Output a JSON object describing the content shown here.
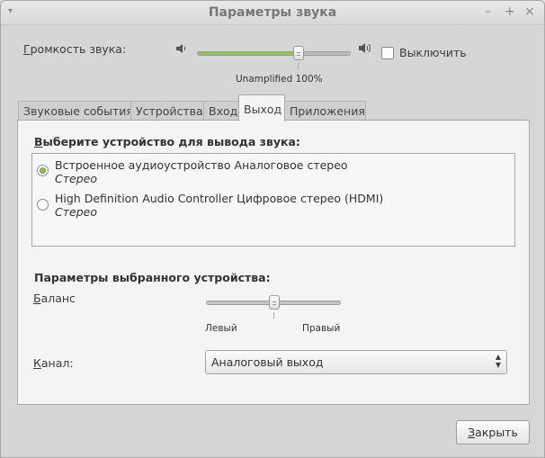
{
  "window": {
    "title": "Параметры звука",
    "menu_glyph": "▾",
    "minimize_glyph": "–",
    "maximize_glyph": "+",
    "close_glyph": "×"
  },
  "volume": {
    "label_first": "Г",
    "label_rest": "ромкость звука:",
    "level_percent": 100,
    "marker_text": "Unamplified 100%",
    "mute_label": "Выключить",
    "mute_checked": false,
    "low_icon": "speaker-low-icon",
    "high_icon": "speaker-high-icon"
  },
  "tabs": [
    {
      "label": "Звуковые события",
      "active": false
    },
    {
      "label": "Устройства",
      "active": false
    },
    {
      "label": "Вход",
      "active": false
    },
    {
      "label": "Выход",
      "active": true
    },
    {
      "label": "Приложения",
      "active": false
    }
  ],
  "output": {
    "title_first": "В",
    "title_rest": "ыберите устройство для вывода звука:",
    "devices": [
      {
        "name": "Встроенное аудиоустройство Аналоговое стерео",
        "subtitle": "Стерео",
        "selected": true
      },
      {
        "name": "High Definition Audio Controller Цифровое стерео (HDMI)",
        "subtitle": "Стерео",
        "selected": false
      }
    ]
  },
  "device_params": {
    "title": "Параметры выбранного устройства:",
    "balance_label_first": "Б",
    "balance_label_rest": "аланс",
    "balance_value": 0,
    "left_label": "Левый",
    "right_label": "Правый",
    "channel_label_first": "К",
    "channel_label_rest": "анал:",
    "channel_value": "Аналоговый выход"
  },
  "footer": {
    "close_first": "З",
    "close_rest": "акрыть"
  },
  "colors": {
    "accent_green": "#8fc45d",
    "window_bg": "#d6d6d6",
    "panel_bg": "#f4f4f4"
  }
}
